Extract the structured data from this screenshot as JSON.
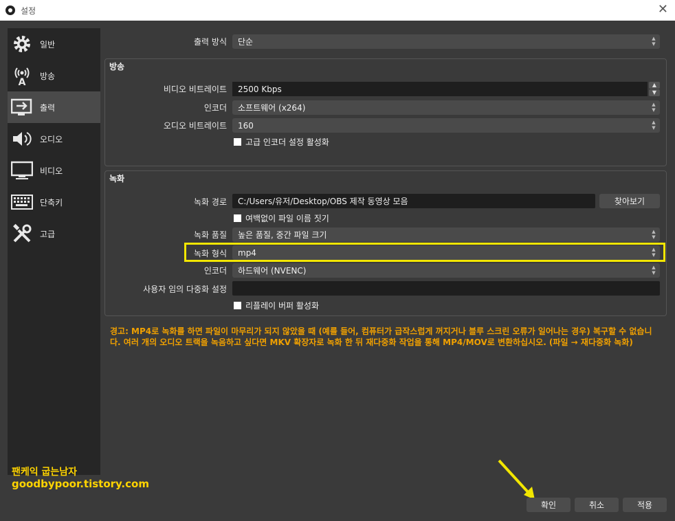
{
  "window": {
    "title": "설정"
  },
  "sidebar": {
    "items": [
      {
        "label": "일반",
        "icon": "gear-icon"
      },
      {
        "label": "방송",
        "icon": "broadcast-icon"
      },
      {
        "label": "출력",
        "icon": "output-icon"
      },
      {
        "label": "오디오",
        "icon": "speaker-icon"
      },
      {
        "label": "비디오",
        "icon": "monitor-icon"
      },
      {
        "label": "단축키",
        "icon": "keyboard-icon"
      },
      {
        "label": "고급",
        "icon": "tools-icon"
      }
    ],
    "active": "출력"
  },
  "output_mode": {
    "label": "출력 방식",
    "value": "단순"
  },
  "streaming": {
    "title": "방송",
    "video_bitrate": {
      "label": "비디오 비트레이트",
      "value": "2500 Kbps"
    },
    "encoder": {
      "label": "인코더",
      "value": "소프트웨어 (x264)"
    },
    "audio_bitrate": {
      "label": "오디오 비트레이트",
      "value": "160"
    },
    "advanced_encoder": {
      "label": "고급 인코더 설정 활성화",
      "checked": false
    }
  },
  "recording": {
    "title": "녹화",
    "path": {
      "label": "녹화 경로",
      "value": "C:/Users/유저/Desktop/OBS 제작 동영상 모음",
      "browse": "찾아보기"
    },
    "no_space_filename": {
      "label": "여백없이 파일 이름 짓기",
      "checked": false
    },
    "quality": {
      "label": "녹화 품질",
      "value": "높은 품질, 중간 파일 크기"
    },
    "format": {
      "label": "녹화 형식",
      "value": "mp4"
    },
    "encoder": {
      "label": "인코더",
      "value": "하드웨어 (NVENC)"
    },
    "custom_muxer": {
      "label": "사용자 임의 다중화 설정",
      "value": ""
    },
    "replay_buffer": {
      "label": "리플레이 버퍼 활성화",
      "checked": false
    }
  },
  "warning": "경고: MP4로 녹화를 하면 파일이 마무리가 되지 않았을 때 (예를 들어, 컴퓨터가 급작스럽게 꺼지거나 블루 스크린 오류가 일어나는 경우) 복구할 수 없습니다. 여러 개의 오디오 트랙을 녹음하고 싶다면 MKV 확장자로 녹화 한 뒤 재다중화 작업을 통해 MP4/MOV로 변환하십시오. (파일 → 재다중화 녹화)",
  "buttons": {
    "ok": "확인",
    "cancel": "취소",
    "apply": "적용"
  },
  "watermark": {
    "line1": "팬케익 굽는남자",
    "line2": "goodbypoor.tistory.com"
  },
  "colors": {
    "highlight": "#f2e600",
    "warning": "#f0a000",
    "watermark": "#ffd400"
  }
}
